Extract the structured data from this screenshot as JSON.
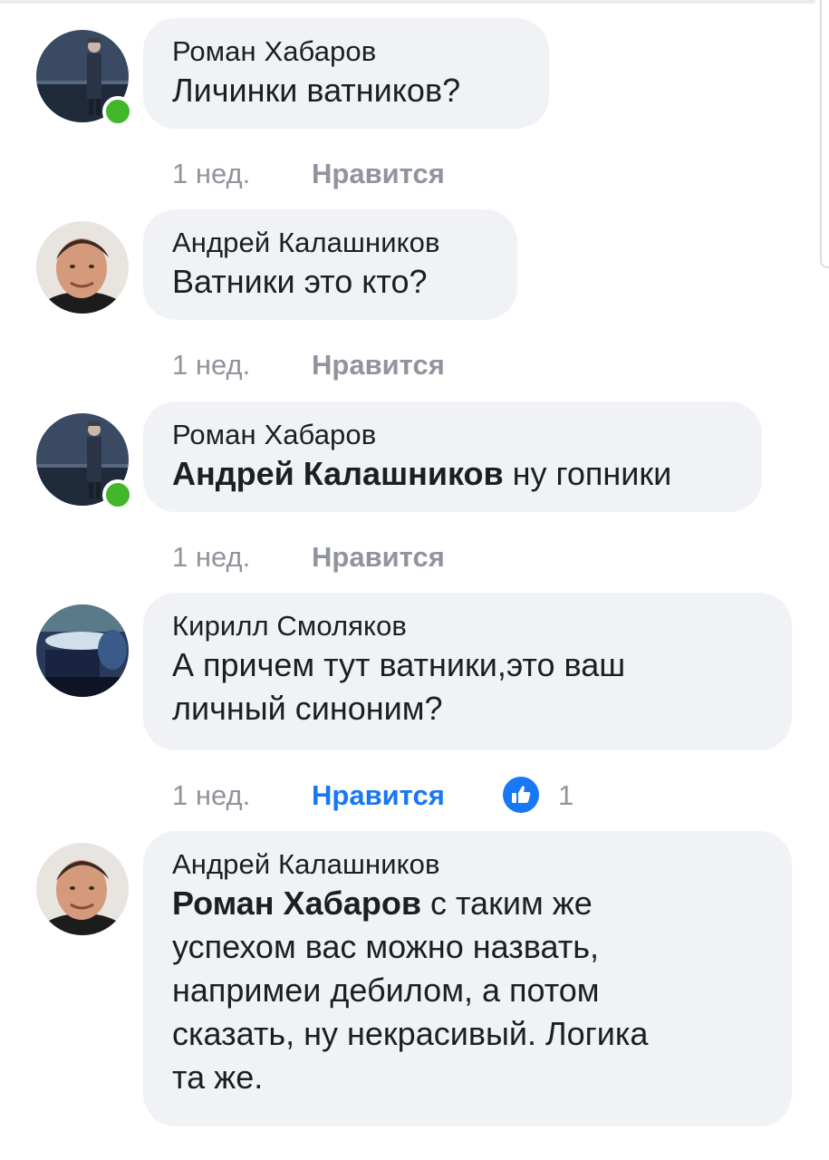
{
  "comments": [
    {
      "author": "Роман Хабаров",
      "mention": "",
      "text": "Личинки ватников?",
      "time": "1 нед.",
      "like_label": "Нравится",
      "online": true
    },
    {
      "author": "Андрей Калашников",
      "mention": "",
      "text": "Ватники это кто?",
      "time": "1 нед.",
      "like_label": "Нравится",
      "online": false
    },
    {
      "author": "Роман Хабаров",
      "mention": "Андрей Калашников",
      "text": " ну гопники",
      "time": "1 нед.",
      "like_label": "Нравится",
      "online": true
    },
    {
      "author": "Кирилл Смоляков",
      "mention": "",
      "text_lines": [
        "А причем тут ватники,это ваш",
        "личный синоним?"
      ],
      "time": "1 нед.",
      "like_label": "Нравится",
      "reaction_icon": "like-thumb-icon",
      "reaction_count": "1",
      "online": false
    },
    {
      "author": "Андрей Калашников",
      "mention": "Роман Хабаров",
      "first_line": " с таким же",
      "text_lines": [
        "успехом вас можно назвать,",
        "напримеи дебилом, а потом",
        "сказать, ну некрасивый. Логика",
        "та же."
      ],
      "online": false
    }
  ],
  "colors": {
    "bubble": "#f0f2f5",
    "meta": "#90949c",
    "like_active": "#1877f2",
    "online": "#42b72a"
  }
}
